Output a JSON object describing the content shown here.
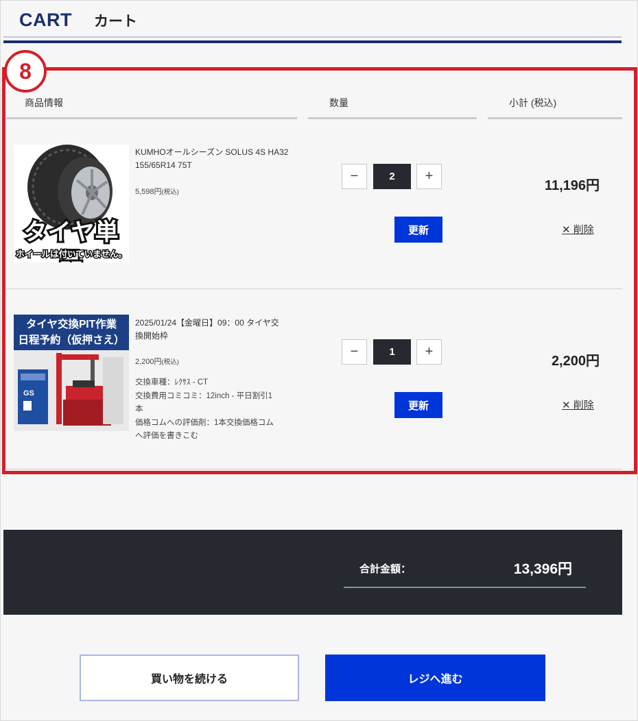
{
  "header": {
    "title_en": "CART",
    "title_jp": "カート"
  },
  "annotation": {
    "number": "8"
  },
  "columns": {
    "product": "商品情報",
    "quantity": "数量",
    "subtotal": "小計 (税込)"
  },
  "items": [
    {
      "name_line1": "KUMHOオールシーズン SOLUS 4S HA32",
      "name_line2": "155/65R14 75T",
      "unit_price": "5,598円",
      "tax_note": "(税込)",
      "thumb_caption": "タイヤ単品",
      "thumb_subcaption": "ホイールは付いていません。",
      "quantity": "2",
      "subtotal": "11,196円",
      "update_label": "更新",
      "delete_label": "✕ 削除"
    },
    {
      "name_line1": "2025/01/24【金曜日】09：00 タイヤ交",
      "name_line2": "換開始枠",
      "unit_price": "2,200円",
      "tax_note": "(税込)",
      "thumb_caption_line1": "タイヤ交換PIT作業",
      "thumb_caption_line2": "日程予約（仮押さえ）",
      "detail_line1": "交換車種：ﾚｸｻｽ - CT",
      "detail_line2": "交換費用コミコミ：12inch - 平日割引1",
      "detail_line3": "本",
      "detail_line4": "価格コムへの評価剤：1本交換価格コム",
      "detail_line5": "へ評価を書きこむ",
      "quantity": "1",
      "subtotal": "2,200円",
      "update_label": "更新",
      "delete_label": "✕ 削除"
    }
  ],
  "qty_controls": {
    "minus": "−",
    "plus": "+"
  },
  "totals": {
    "label": "合計金額：",
    "value": "13,396円"
  },
  "actions": {
    "continue_label": "買い物を続ける",
    "checkout_label": "レジへ進む"
  },
  "colors": {
    "brand": "#1b2f6e",
    "accent": "#0035d9",
    "annotation": "#d51f28",
    "dark": "#262a30"
  }
}
